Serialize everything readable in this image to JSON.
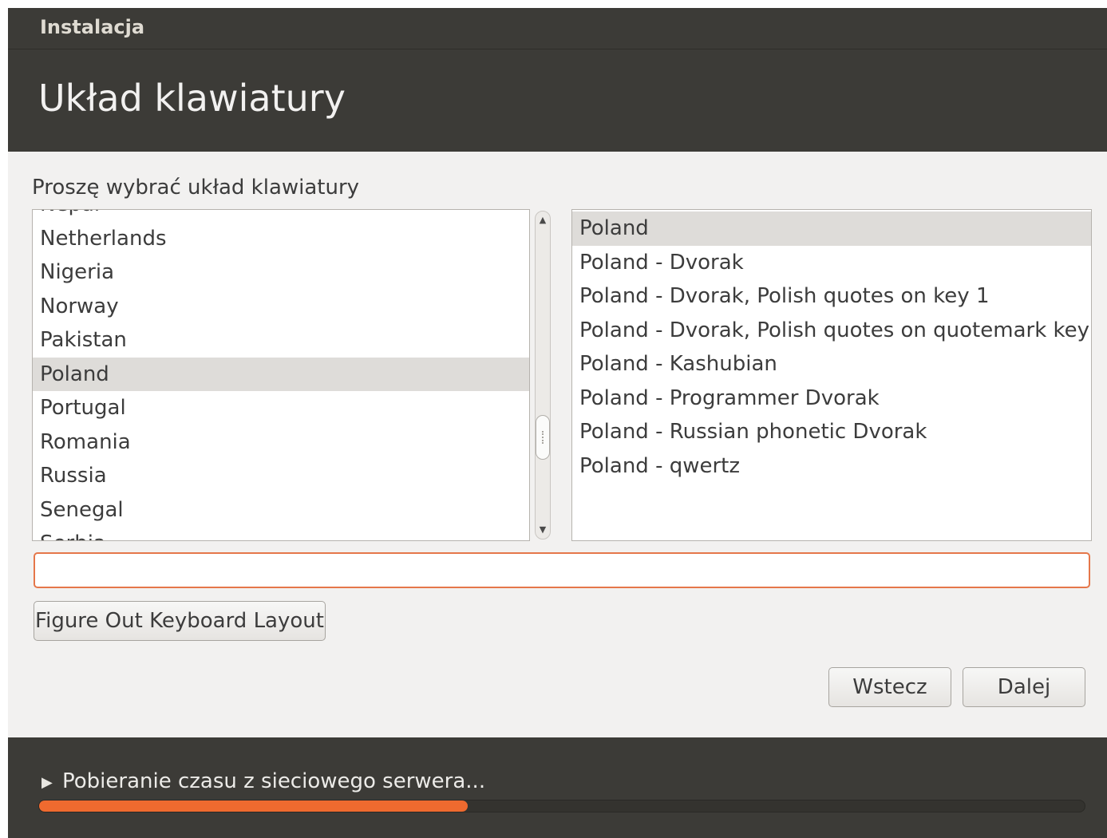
{
  "window": {
    "title": "Instalacja",
    "page_title": "Układ klawiatury"
  },
  "prompt": "Proszę wybrać układ klawiatury",
  "country_list": {
    "items": [
      "Nepal",
      "Netherlands",
      "Nigeria",
      "Norway",
      "Pakistan",
      "Poland",
      "Portugal",
      "Romania",
      "Russia",
      "Senegal",
      "Serbia"
    ],
    "selected": "Poland"
  },
  "variant_list": {
    "items": [
      "Poland",
      "Poland - Dvorak",
      "Poland - Dvorak, Polish quotes on key 1",
      "Poland - Dvorak, Polish quotes on quotemark key",
      "Poland - Kashubian",
      "Poland - Programmer Dvorak",
      "Poland - Russian phonetic Dvorak",
      "Poland - qwertz"
    ],
    "selected": "Poland"
  },
  "search": {
    "value": ""
  },
  "buttons": {
    "figure_out": "Figure Out Keyboard Layout",
    "back": "Wstecz",
    "next": "Dalej"
  },
  "status": {
    "text": "Pobieranie czasu z sieciowego serwera...",
    "progress": 0.41
  },
  "colors": {
    "header_bg": "#3c3b37",
    "accent": "#ef6a2f",
    "selection_bg": "#dedcd9"
  }
}
